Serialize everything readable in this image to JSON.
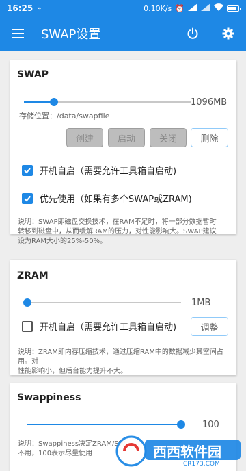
{
  "status_bar": {
    "time": "16:25",
    "speed": "0.10K/s"
  },
  "app_bar": {
    "title": "SWAP设置",
    "menu_icon": "hamburger-menu-icon",
    "power_icon": "power-icon",
    "settings_icon": "gear-icon"
  },
  "swap": {
    "title": "SWAP",
    "size_value": "1096MB",
    "slider_fraction": 0.18,
    "path_label": "存储位置：/data/swapfile",
    "buttons": {
      "create": "创建",
      "start": "启动",
      "stop": "关闭",
      "delete": "删除"
    },
    "autostart_label": "开机自启（需要允许工具箱自启动)",
    "autostart_checked": true,
    "priority_label": "优先使用（如果有多个SWAP或ZRAM)",
    "priority_checked": true,
    "description_line1": "说明：SWAP即磁盘交换技术，在RAM不足时，将一部分数据暂时",
    "description_line2": "转移到磁盘中，从而缓解RAM的压力，对性能影响大。SWAP建议",
    "description_line3": "设为RAM大小的25%-50%。"
  },
  "zram": {
    "title": "ZRAM",
    "size_value": "1MB",
    "slider_fraction": 0.0,
    "autostart_label": "开机自启（需要允许工具箱自启动)",
    "autostart_checked": false,
    "adjust_button": "调整",
    "description_line1": "说明：ZRAM即内存压缩技术，通过压缩RAM中的数据减少其空间占用。对",
    "description_line2": "性能影响小，但后台能力提升不大。"
  },
  "swappiness": {
    "title": "Swappiness",
    "value": "100",
    "slider_fraction": 1.0,
    "description_line1": "说明：Swappiness决定ZRAM/SW",
    "description_line2": "不用，100表示尽量使用"
  },
  "watermark": {
    "text": "西西软件园",
    "sub": "CR173.COM"
  },
  "colors": {
    "primary": "#1e88e5",
    "background": "#eeeeee"
  }
}
